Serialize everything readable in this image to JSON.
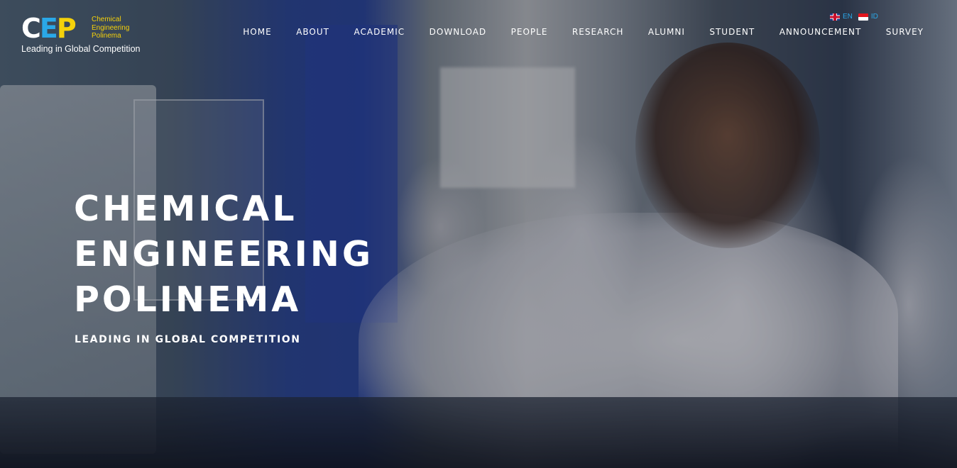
{
  "header": {
    "logo": {
      "letters": [
        "C",
        "E",
        "P"
      ],
      "subtitle_lines": [
        "Chemical",
        "Engineering",
        "Polinema"
      ],
      "tagline": "Leading in Global Competition"
    },
    "languages": [
      {
        "code": "EN",
        "flag": "uk-flag-icon"
      },
      {
        "code": "ID",
        "flag": "indonesia-flag-icon"
      }
    ],
    "nav": [
      "HOME",
      "ABOUT",
      "ACADEMIC",
      "DOWNLOAD",
      "PEOPLE",
      "RESEARCH",
      "ALUMNI",
      "STUDENT",
      "ANNOUNCEMENT",
      "SURVEY"
    ]
  },
  "hero": {
    "title_lines": [
      "CHEMICAL",
      "ENGINEERING",
      "POLINEMA"
    ],
    "subtitle": "LEADING IN GLOBAL COMPETITION",
    "background": "photo of students in white lab coats operating chemical engineering lab equipment"
  },
  "colors": {
    "logo_white": "#ffffff",
    "logo_blue": "#2aa8e8",
    "logo_yellow": "#f5d10a",
    "nav_text": "#ffffff",
    "lang_text": "#2aa8e8"
  }
}
